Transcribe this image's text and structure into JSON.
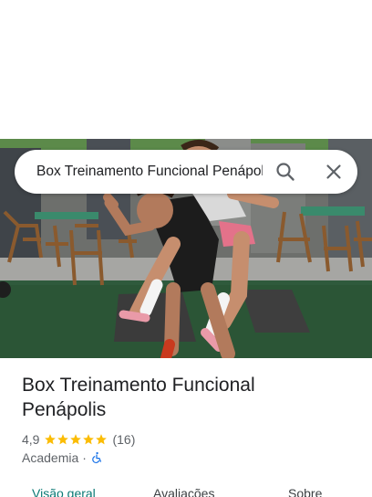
{
  "search": {
    "query": "Box Treinamento Funcional Penápolis"
  },
  "place": {
    "name": "Box Treinamento Funcional Penápolis",
    "rating": "4,9",
    "stars": 5,
    "review_count": "(16)",
    "category": "Academia",
    "separator": "·"
  },
  "tabs": [
    {
      "label": "Visão geral",
      "active": true
    },
    {
      "label": "Avaliações",
      "active": false
    },
    {
      "label": "Sobre",
      "active": false
    }
  ],
  "colors": {
    "star": "#fbbc04",
    "accent_tab": "#0b7a75",
    "accessibility_icon": "#1a73e8"
  },
  "icons": {
    "search": "search-icon",
    "close": "close-icon",
    "accessibility": "wheelchair-accessible-icon"
  }
}
